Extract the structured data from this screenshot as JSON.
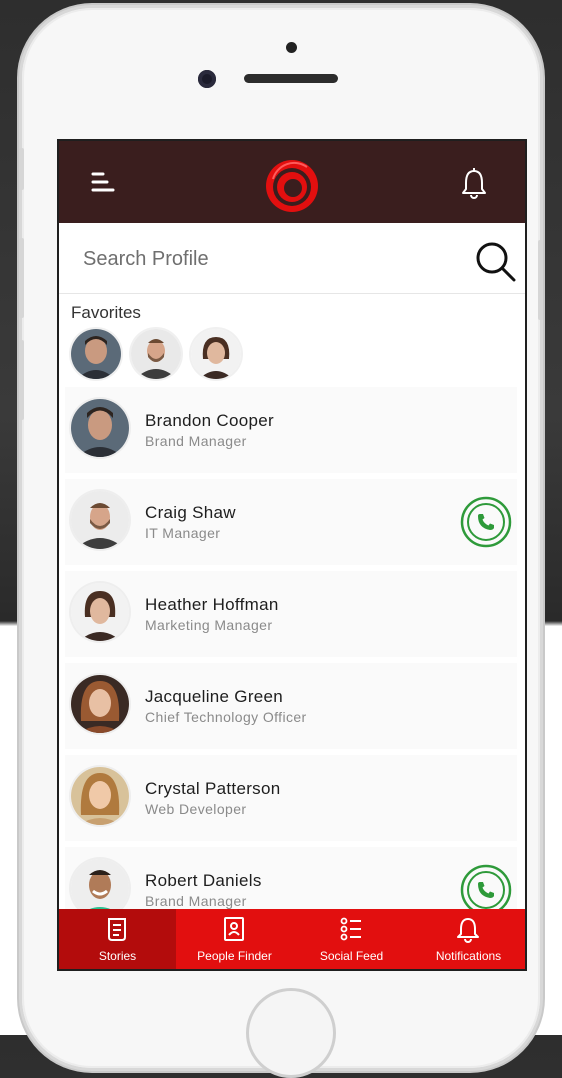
{
  "app": {
    "brand_color": "#e20f0f",
    "topbar_color": "#3a1e1e"
  },
  "header": {
    "menu_icon": "menu-icon",
    "logo_icon": "ring-logo-icon",
    "notification_icon": "bell-icon"
  },
  "search": {
    "placeholder": "Search Profile",
    "value": ""
  },
  "favorites": {
    "label": "Favorites"
  },
  "contacts": [
    {
      "name": "Brandon Cooper",
      "role": "Brand Manager",
      "call": false
    },
    {
      "name": "Craig Shaw",
      "role": "IT Manager",
      "call": true
    },
    {
      "name": "Heather Hoffman",
      "role": "Marketing Manager",
      "call": false
    },
    {
      "name": "Jacqueline Green",
      "role": "Chief Technology Officer",
      "call": false
    },
    {
      "name": "Crystal Patterson",
      "role": "Web Developer",
      "call": false
    },
    {
      "name": "Robert Daniels",
      "role": "Brand Manager",
      "call": true
    }
  ],
  "nav": [
    {
      "label": "Stories",
      "icon": "stories-icon",
      "active": true
    },
    {
      "label": "People Finder",
      "icon": "contacts-book-icon",
      "active": false
    },
    {
      "label": "Social Feed",
      "icon": "list-icon",
      "active": false
    },
    {
      "label": "Notifications",
      "icon": "bell-icon",
      "active": false
    }
  ]
}
